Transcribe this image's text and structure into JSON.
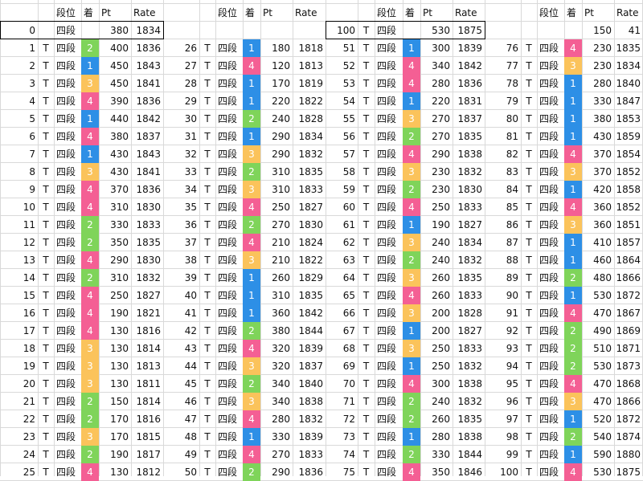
{
  "headers": {
    "dan": "段位",
    "chaku": "着",
    "pt": "Pt",
    "rate": "Rate"
  },
  "colors": {
    "1": "#2d8fe6",
    "2": "#7fd45a",
    "3": "#fbc35b",
    "4": "#f45f94"
  },
  "row0": [
    {
      "idx": "0",
      "t": "",
      "dan": "四段",
      "pos": "",
      "pt": "380",
      "rate": "1834"
    },
    {
      "idx": "",
      "t": "",
      "dan": "",
      "pos": "",
      "pt": "",
      "rate": ""
    },
    {
      "idx": "100",
      "t": "T",
      "dan": "四段",
      "pos": "",
      "pt": "530",
      "rate": "1875"
    },
    {
      "idx": "",
      "t": "",
      "dan": "",
      "pos": "",
      "pt": "150",
      "rate": "41"
    }
  ],
  "rows": [
    [
      {
        "idx": "1",
        "t": "T",
        "dan": "四段",
        "pos": "2",
        "pt": "400",
        "rate": "1836"
      },
      {
        "idx": "26",
        "t": "T",
        "dan": "四段",
        "pos": "1",
        "pt": "180",
        "rate": "1818"
      },
      {
        "idx": "51",
        "t": "T",
        "dan": "四段",
        "pos": "1",
        "pt": "300",
        "rate": "1839"
      },
      {
        "idx": "76",
        "t": "T",
        "dan": "四段",
        "pos": "4",
        "pt": "230",
        "rate": "1835"
      }
    ],
    [
      {
        "idx": "2",
        "t": "T",
        "dan": "四段",
        "pos": "1",
        "pt": "450",
        "rate": "1843"
      },
      {
        "idx": "27",
        "t": "T",
        "dan": "四段",
        "pos": "4",
        "pt": "120",
        "rate": "1813"
      },
      {
        "idx": "52",
        "t": "T",
        "dan": "四段",
        "pos": "4",
        "pt": "340",
        "rate": "1842"
      },
      {
        "idx": "77",
        "t": "T",
        "dan": "四段",
        "pos": "3",
        "pt": "230",
        "rate": "1834"
      }
    ],
    [
      {
        "idx": "3",
        "t": "T",
        "dan": "四段",
        "pos": "3",
        "pt": "450",
        "rate": "1841"
      },
      {
        "idx": "28",
        "t": "T",
        "dan": "四段",
        "pos": "1",
        "pt": "170",
        "rate": "1819"
      },
      {
        "idx": "53",
        "t": "T",
        "dan": "四段",
        "pos": "4",
        "pt": "280",
        "rate": "1836"
      },
      {
        "idx": "78",
        "t": "T",
        "dan": "四段",
        "pos": "1",
        "pt": "280",
        "rate": "1840"
      }
    ],
    [
      {
        "idx": "4",
        "t": "T",
        "dan": "四段",
        "pos": "4",
        "pt": "390",
        "rate": "1836"
      },
      {
        "idx": "29",
        "t": "T",
        "dan": "四段",
        "pos": "1",
        "pt": "220",
        "rate": "1822"
      },
      {
        "idx": "54",
        "t": "T",
        "dan": "四段",
        "pos": "1",
        "pt": "220",
        "rate": "1831"
      },
      {
        "idx": "79",
        "t": "T",
        "dan": "四段",
        "pos": "1",
        "pt": "330",
        "rate": "1847"
      }
    ],
    [
      {
        "idx": "5",
        "t": "T",
        "dan": "四段",
        "pos": "1",
        "pt": "440",
        "rate": "1842"
      },
      {
        "idx": "30",
        "t": "T",
        "dan": "四段",
        "pos": "2",
        "pt": "240",
        "rate": "1828"
      },
      {
        "idx": "55",
        "t": "T",
        "dan": "四段",
        "pos": "3",
        "pt": "270",
        "rate": "1837"
      },
      {
        "idx": "80",
        "t": "T",
        "dan": "四段",
        "pos": "1",
        "pt": "380",
        "rate": "1853"
      }
    ],
    [
      {
        "idx": "6",
        "t": "T",
        "dan": "四段",
        "pos": "4",
        "pt": "380",
        "rate": "1837"
      },
      {
        "idx": "31",
        "t": "T",
        "dan": "四段",
        "pos": "1",
        "pt": "290",
        "rate": "1834"
      },
      {
        "idx": "56",
        "t": "T",
        "dan": "四段",
        "pos": "2",
        "pt": "270",
        "rate": "1835"
      },
      {
        "idx": "81",
        "t": "T",
        "dan": "四段",
        "pos": "1",
        "pt": "430",
        "rate": "1859"
      }
    ],
    [
      {
        "idx": "7",
        "t": "T",
        "dan": "四段",
        "pos": "1",
        "pt": "430",
        "rate": "1843"
      },
      {
        "idx": "32",
        "t": "T",
        "dan": "四段",
        "pos": "3",
        "pt": "290",
        "rate": "1832"
      },
      {
        "idx": "57",
        "t": "T",
        "dan": "四段",
        "pos": "4",
        "pt": "290",
        "rate": "1838"
      },
      {
        "idx": "82",
        "t": "T",
        "dan": "四段",
        "pos": "4",
        "pt": "370",
        "rate": "1854"
      }
    ],
    [
      {
        "idx": "8",
        "t": "T",
        "dan": "四段",
        "pos": "3",
        "pt": "430",
        "rate": "1841"
      },
      {
        "idx": "33",
        "t": "T",
        "dan": "四段",
        "pos": "2",
        "pt": "310",
        "rate": "1835"
      },
      {
        "idx": "58",
        "t": "T",
        "dan": "四段",
        "pos": "3",
        "pt": "230",
        "rate": "1832"
      },
      {
        "idx": "83",
        "t": "T",
        "dan": "四段",
        "pos": "3",
        "pt": "370",
        "rate": "1852"
      }
    ],
    [
      {
        "idx": "9",
        "t": "T",
        "dan": "四段",
        "pos": "4",
        "pt": "370",
        "rate": "1836"
      },
      {
        "idx": "34",
        "t": "T",
        "dan": "四段",
        "pos": "3",
        "pt": "310",
        "rate": "1833"
      },
      {
        "idx": "59",
        "t": "T",
        "dan": "四段",
        "pos": "2",
        "pt": "230",
        "rate": "1830"
      },
      {
        "idx": "84",
        "t": "T",
        "dan": "四段",
        "pos": "1",
        "pt": "420",
        "rate": "1858"
      }
    ],
    [
      {
        "idx": "10",
        "t": "T",
        "dan": "四段",
        "pos": "4",
        "pt": "310",
        "rate": "1830"
      },
      {
        "idx": "35",
        "t": "T",
        "dan": "四段",
        "pos": "4",
        "pt": "250",
        "rate": "1827"
      },
      {
        "idx": "60",
        "t": "T",
        "dan": "四段",
        "pos": "4",
        "pt": "250",
        "rate": "1833"
      },
      {
        "idx": "85",
        "t": "T",
        "dan": "四段",
        "pos": "4",
        "pt": "360",
        "rate": "1852"
      }
    ],
    [
      {
        "idx": "11",
        "t": "T",
        "dan": "四段",
        "pos": "2",
        "pt": "330",
        "rate": "1833"
      },
      {
        "idx": "36",
        "t": "T",
        "dan": "四段",
        "pos": "2",
        "pt": "270",
        "rate": "1830"
      },
      {
        "idx": "61",
        "t": "T",
        "dan": "四段",
        "pos": "1",
        "pt": "190",
        "rate": "1827"
      },
      {
        "idx": "86",
        "t": "T",
        "dan": "四段",
        "pos": "3",
        "pt": "360",
        "rate": "1851"
      }
    ],
    [
      {
        "idx": "12",
        "t": "T",
        "dan": "四段",
        "pos": "2",
        "pt": "350",
        "rate": "1835"
      },
      {
        "idx": "37",
        "t": "T",
        "dan": "四段",
        "pos": "4",
        "pt": "210",
        "rate": "1824"
      },
      {
        "idx": "62",
        "t": "T",
        "dan": "四段",
        "pos": "3",
        "pt": "240",
        "rate": "1834"
      },
      {
        "idx": "87",
        "t": "T",
        "dan": "四段",
        "pos": "1",
        "pt": "410",
        "rate": "1857"
      }
    ],
    [
      {
        "idx": "13",
        "t": "T",
        "dan": "四段",
        "pos": "4",
        "pt": "290",
        "rate": "1830"
      },
      {
        "idx": "38",
        "t": "T",
        "dan": "四段",
        "pos": "3",
        "pt": "210",
        "rate": "1822"
      },
      {
        "idx": "63",
        "t": "T",
        "dan": "四段",
        "pos": "2",
        "pt": "240",
        "rate": "1832"
      },
      {
        "idx": "88",
        "t": "T",
        "dan": "四段",
        "pos": "1",
        "pt": "460",
        "rate": "1864"
      }
    ],
    [
      {
        "idx": "14",
        "t": "T",
        "dan": "四段",
        "pos": "2",
        "pt": "310",
        "rate": "1832"
      },
      {
        "idx": "39",
        "t": "T",
        "dan": "四段",
        "pos": "1",
        "pt": "260",
        "rate": "1829"
      },
      {
        "idx": "64",
        "t": "T",
        "dan": "四段",
        "pos": "3",
        "pt": "260",
        "rate": "1835"
      },
      {
        "idx": "89",
        "t": "T",
        "dan": "四段",
        "pos": "2",
        "pt": "480",
        "rate": "1866"
      }
    ],
    [
      {
        "idx": "15",
        "t": "T",
        "dan": "四段",
        "pos": "4",
        "pt": "250",
        "rate": "1827"
      },
      {
        "idx": "40",
        "t": "T",
        "dan": "四段",
        "pos": "1",
        "pt": "310",
        "rate": "1835"
      },
      {
        "idx": "65",
        "t": "T",
        "dan": "四段",
        "pos": "4",
        "pt": "260",
        "rate": "1833"
      },
      {
        "idx": "90",
        "t": "T",
        "dan": "四段",
        "pos": "1",
        "pt": "530",
        "rate": "1872"
      }
    ],
    [
      {
        "idx": "16",
        "t": "T",
        "dan": "四段",
        "pos": "4",
        "pt": "190",
        "rate": "1821"
      },
      {
        "idx": "41",
        "t": "T",
        "dan": "四段",
        "pos": "1",
        "pt": "360",
        "rate": "1842"
      },
      {
        "idx": "66",
        "t": "T",
        "dan": "四段",
        "pos": "3",
        "pt": "200",
        "rate": "1828"
      },
      {
        "idx": "91",
        "t": "T",
        "dan": "四段",
        "pos": "4",
        "pt": "470",
        "rate": "1867"
      }
    ],
    [
      {
        "idx": "17",
        "t": "T",
        "dan": "四段",
        "pos": "4",
        "pt": "130",
        "rate": "1816"
      },
      {
        "idx": "42",
        "t": "T",
        "dan": "四段",
        "pos": "2",
        "pt": "380",
        "rate": "1844"
      },
      {
        "idx": "67",
        "t": "T",
        "dan": "四段",
        "pos": "1",
        "pt": "200",
        "rate": "1827"
      },
      {
        "idx": "92",
        "t": "T",
        "dan": "四段",
        "pos": "2",
        "pt": "490",
        "rate": "1869"
      }
    ],
    [
      {
        "idx": "18",
        "t": "T",
        "dan": "四段",
        "pos": "3",
        "pt": "130",
        "rate": "1814"
      },
      {
        "idx": "43",
        "t": "T",
        "dan": "四段",
        "pos": "4",
        "pt": "320",
        "rate": "1839"
      },
      {
        "idx": "68",
        "t": "T",
        "dan": "四段",
        "pos": "3",
        "pt": "250",
        "rate": "1833"
      },
      {
        "idx": "93",
        "t": "T",
        "dan": "四段",
        "pos": "2",
        "pt": "510",
        "rate": "1871"
      }
    ],
    [
      {
        "idx": "19",
        "t": "T",
        "dan": "四段",
        "pos": "3",
        "pt": "130",
        "rate": "1813"
      },
      {
        "idx": "44",
        "t": "T",
        "dan": "四段",
        "pos": "3",
        "pt": "320",
        "rate": "1837"
      },
      {
        "idx": "69",
        "t": "T",
        "dan": "四段",
        "pos": "1",
        "pt": "250",
        "rate": "1832"
      },
      {
        "idx": "94",
        "t": "T",
        "dan": "四段",
        "pos": "2",
        "pt": "530",
        "rate": "1873"
      }
    ],
    [
      {
        "idx": "20",
        "t": "T",
        "dan": "四段",
        "pos": "3",
        "pt": "130",
        "rate": "1811"
      },
      {
        "idx": "45",
        "t": "T",
        "dan": "四段",
        "pos": "2",
        "pt": "340",
        "rate": "1840"
      },
      {
        "idx": "70",
        "t": "T",
        "dan": "四段",
        "pos": "4",
        "pt": "300",
        "rate": "1838"
      },
      {
        "idx": "95",
        "t": "T",
        "dan": "四段",
        "pos": "4",
        "pt": "470",
        "rate": "1868"
      }
    ],
    [
      {
        "idx": "21",
        "t": "T",
        "dan": "四段",
        "pos": "2",
        "pt": "150",
        "rate": "1814"
      },
      {
        "idx": "46",
        "t": "T",
        "dan": "四段",
        "pos": "3",
        "pt": "340",
        "rate": "1838"
      },
      {
        "idx": "71",
        "t": "T",
        "dan": "四段",
        "pos": "2",
        "pt": "240",
        "rate": "1832"
      },
      {
        "idx": "96",
        "t": "T",
        "dan": "四段",
        "pos": "3",
        "pt": "470",
        "rate": "1866"
      }
    ],
    [
      {
        "idx": "22",
        "t": "T",
        "dan": "四段",
        "pos": "2",
        "pt": "170",
        "rate": "1816"
      },
      {
        "idx": "47",
        "t": "T",
        "dan": "四段",
        "pos": "4",
        "pt": "280",
        "rate": "1832"
      },
      {
        "idx": "72",
        "t": "T",
        "dan": "四段",
        "pos": "2",
        "pt": "260",
        "rate": "1835"
      },
      {
        "idx": "97",
        "t": "T",
        "dan": "四段",
        "pos": "1",
        "pt": "520",
        "rate": "1872"
      }
    ],
    [
      {
        "idx": "23",
        "t": "T",
        "dan": "四段",
        "pos": "3",
        "pt": "170",
        "rate": "1815"
      },
      {
        "idx": "48",
        "t": "T",
        "dan": "四段",
        "pos": "1",
        "pt": "330",
        "rate": "1839"
      },
      {
        "idx": "73",
        "t": "T",
        "dan": "四段",
        "pos": "1",
        "pt": "280",
        "rate": "1838"
      },
      {
        "idx": "98",
        "t": "T",
        "dan": "四段",
        "pos": "2",
        "pt": "540",
        "rate": "1874"
      }
    ],
    [
      {
        "idx": "24",
        "t": "T",
        "dan": "四段",
        "pos": "2",
        "pt": "190",
        "rate": "1817"
      },
      {
        "idx": "49",
        "t": "T",
        "dan": "四段",
        "pos": "4",
        "pt": "270",
        "rate": "1833"
      },
      {
        "idx": "74",
        "t": "T",
        "dan": "四段",
        "pos": "2",
        "pt": "330",
        "rate": "1844"
      },
      {
        "idx": "99",
        "t": "T",
        "dan": "四段",
        "pos": "1",
        "pt": "590",
        "rate": "1880"
      }
    ],
    [
      {
        "idx": "25",
        "t": "T",
        "dan": "四段",
        "pos": "4",
        "pt": "130",
        "rate": "1812"
      },
      {
        "idx": "50",
        "t": "T",
        "dan": "四段",
        "pos": "2",
        "pt": "290",
        "rate": "1836"
      },
      {
        "idx": "75",
        "t": "T",
        "dan": "四段",
        "pos": "4",
        "pt": "350",
        "rate": "1846"
      },
      {
        "idx": "100",
        "t": "T",
        "dan": "四段",
        "pos": "4",
        "pt": "530",
        "rate": "1875"
      }
    ]
  ]
}
